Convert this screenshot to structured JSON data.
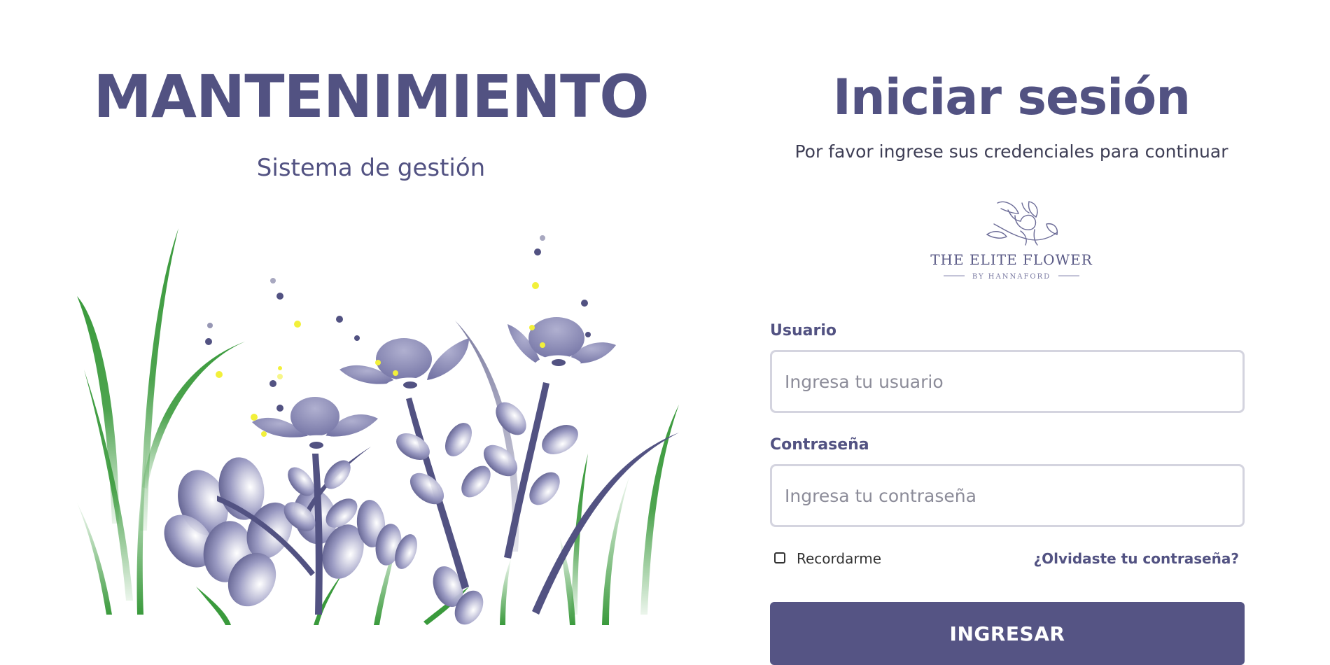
{
  "hero": {
    "title": "MANTENIMIENTO",
    "subtitle": "Sistema de gestión"
  },
  "login": {
    "title": "Iniciar sesión",
    "subtitle": "Por favor ingrese sus credenciales para continuar",
    "logo": {
      "name": "THE ELITE FLOWER",
      "tagline": "BY HANNAFORD"
    },
    "username": {
      "label": "Usuario",
      "placeholder": "Ingresa tu usuario",
      "value": ""
    },
    "password": {
      "label": "Contraseña",
      "placeholder": "Ingresa tu contraseña",
      "value": ""
    },
    "remember_label": "Recordarme",
    "forgot_label": "¿Olvidaste tu contraseña?",
    "submit_label": "INGRESAR"
  },
  "colors": {
    "primary": "#555484",
    "text": "#525282",
    "leaf_green": "#3a9a3c",
    "flower": "#8a8ab6",
    "sparkle": "#f2f03a"
  },
  "icons": {
    "illustration": "flower-garden-illustration",
    "logo": "elite-flower-logo-icon"
  }
}
